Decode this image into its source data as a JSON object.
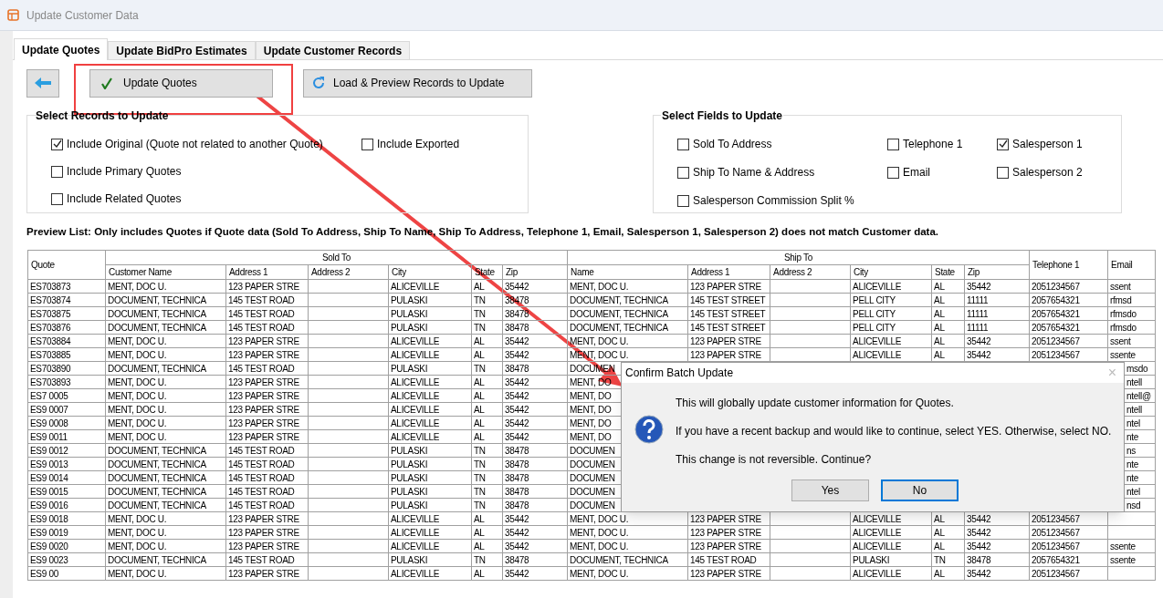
{
  "window": {
    "title": "Update Customer Data"
  },
  "tabs": [
    {
      "label": "Update Quotes",
      "selected": true
    },
    {
      "label": "Update BidPro Estimates",
      "selected": false
    },
    {
      "label": "Update Customer Records",
      "selected": false
    }
  ],
  "toolbar": {
    "update_button": "Update Quotes",
    "load_button": "Load & Preview Records to Update"
  },
  "records_group": {
    "title": "Select Records to Update",
    "options": [
      {
        "label": "Include Original (Quote not related to another Quote)",
        "checked": true
      },
      {
        "label": "Include Exported",
        "checked": false
      },
      {
        "label": "Include Primary Quotes",
        "checked": false
      },
      {
        "label": "Include Related Quotes",
        "checked": false
      }
    ]
  },
  "fields_group": {
    "title": "Select Fields to Update",
    "options": [
      {
        "label": "Sold To Address",
        "checked": false
      },
      {
        "label": "Telephone 1",
        "checked": false
      },
      {
        "label": "Salesperson 1",
        "checked": true
      },
      {
        "label": "Ship To Name & Address",
        "checked": false
      },
      {
        "label": "Email",
        "checked": false
      },
      {
        "label": "Salesperson 2",
        "checked": false
      },
      {
        "label": "Salesperson Commission Split %",
        "checked": false
      }
    ]
  },
  "preview_note": "Preview List:  Only includes Quotes if Quote data (Sold To Address, Ship To Name, Ship To Address, Telephone 1, Email, Salesperson 1, Salesperson 2) does not match Customer data.",
  "table": {
    "groups": [
      "Sold To",
      "Ship To"
    ],
    "columns": [
      "Quote",
      "Customer Name",
      "Address 1",
      "Address 2",
      "City",
      "State",
      "Zip",
      "Name",
      "Address 1",
      "Address 2",
      "City",
      "State",
      "Zip",
      "Telephone 1",
      "Email"
    ],
    "rows": [
      {
        "cells": [
          "ES703873",
          "MENT, DOC U.",
          "123 PAPER STRE",
          null,
          "ALICEVILLE",
          "AL",
          "35442",
          "MENT, DOC U.",
          "123 PAPER STRE",
          null,
          "ALICEVILLE",
          "AL",
          "35442",
          "2051234567",
          "ssent"
        ]
      },
      {
        "cells": [
          "ES703874",
          "DOCUMENT, TECHNICA",
          "145 TEST ROAD",
          null,
          "PULASKI",
          "TN",
          "38478",
          "DOCUMENT, TECHNICA",
          "145 TEST STREET",
          null,
          "PELL CITY",
          "AL",
          "11111",
          "2057654321",
          "rfmsd"
        ]
      },
      {
        "cells": [
          "ES703875",
          "DOCUMENT, TECHNICA",
          "145 TEST ROAD",
          null,
          "PULASKI",
          "TN",
          "38478",
          "DOCUMENT, TECHNICA",
          "145 TEST STREET",
          null,
          "PELL CITY",
          "AL",
          "11111",
          "2057654321",
          "rfmsdo"
        ]
      },
      {
        "cells": [
          "ES703876",
          "DOCUMENT, TECHNICA",
          "145 TEST ROAD",
          null,
          "PULASKI",
          "TN",
          "38478",
          "DOCUMENT, TECHNICA",
          "145 TEST STREET",
          null,
          "PELL CITY",
          "AL",
          "11111",
          "2057654321",
          "rfmsdo"
        ]
      },
      {
        "cells": [
          "ES703884",
          "MENT, DOC U.",
          "123 PAPER STRE",
          null,
          "ALICEVILLE",
          "AL",
          "35442",
          "MENT, DOC U.",
          "123 PAPER STRE",
          null,
          "ALICEVILLE",
          "AL",
          "35442",
          "2051234567",
          "ssent"
        ]
      },
      {
        "cells": [
          "ES703885",
          "MENT, DOC U.",
          "123 PAPER STRE",
          null,
          "ALICEVILLE",
          "AL",
          "35442",
          "MENT, DOC U.",
          "123 PAPER STRE",
          null,
          "ALICEVILLE",
          "AL",
          "35442",
          "2051234567",
          "ssente"
        ]
      },
      {
        "cells": [
          "ES703890",
          "DOCUMENT, TECHNICA",
          "145 TEST ROAD",
          null,
          "PULASKI",
          "TN",
          "38478",
          "DOCUMEN",
          null,
          null,
          null,
          null,
          null,
          null,
          "msdo"
        ]
      },
      {
        "cells": [
          "ES703893",
          "MENT, DOC U.",
          "123 PAPER STRE",
          null,
          "ALICEVILLE",
          "AL",
          "35442",
          "MENT, DO",
          null,
          null,
          null,
          null,
          null,
          null,
          "ntell"
        ]
      },
      {
        "cells": [
          "ES7 0005",
          "MENT, DOC U.",
          "123 PAPER STRE",
          null,
          "ALICEVILLE",
          "AL",
          "35442",
          "MENT, DO",
          null,
          null,
          null,
          null,
          null,
          null,
          "ntell@"
        ]
      },
      {
        "cells": [
          "ES9 0007",
          "MENT, DOC U.",
          "123 PAPER STRE",
          null,
          "ALICEVILLE",
          "AL",
          "35442",
          "MENT, DO",
          null,
          null,
          null,
          null,
          null,
          null,
          "ntell"
        ]
      },
      {
        "cells": [
          "ES9 0008",
          "MENT, DOC U.",
          "123 PAPER STRE",
          null,
          "ALICEVILLE",
          "AL",
          "35442",
          "MENT, DO",
          null,
          null,
          null,
          null,
          null,
          null,
          "ntel"
        ]
      },
      {
        "cells": [
          "ES9 0011",
          "MENT, DOC U.",
          "123 PAPER STRE",
          null,
          "ALICEVILLE",
          "AL",
          "35442",
          "MENT, DO",
          null,
          null,
          null,
          null,
          null,
          null,
          "nte"
        ]
      },
      {
        "cells": [
          "ES9 0012",
          "DOCUMENT, TECHNICA",
          "145 TEST ROAD",
          null,
          "PULASKI",
          "TN",
          "38478",
          "DOCUMEN",
          null,
          null,
          null,
          null,
          null,
          null,
          "ns"
        ]
      },
      {
        "cells": [
          "ES9 0013",
          "DOCUMENT, TECHNICA",
          "145 TEST ROAD",
          null,
          "PULASKI",
          "TN",
          "38478",
          "DOCUMEN",
          null,
          null,
          null,
          null,
          null,
          null,
          "nte"
        ]
      },
      {
        "cells": [
          "ES9 0014",
          "DOCUMENT, TECHNICA",
          "145 TEST ROAD",
          null,
          "PULASKI",
          "TN",
          "38478",
          "DOCUMEN",
          null,
          null,
          null,
          null,
          null,
          null,
          "nte"
        ]
      },
      {
        "cells": [
          "ES9 0015",
          "DOCUMENT, TECHNICA",
          "145 TEST ROAD",
          null,
          "PULASKI",
          "TN",
          "38478",
          "DOCUMEN",
          null,
          null,
          null,
          null,
          null,
          null,
          "ntel"
        ]
      },
      {
        "cells": [
          "ES9 0016",
          "DOCUMENT, TECHNICA",
          "145 TEST ROAD",
          null,
          "PULASKI",
          "TN",
          "38478",
          "DOCUMEN",
          null,
          null,
          null,
          null,
          null,
          null,
          "nsd"
        ]
      },
      {
        "cells": [
          "ES9 0018",
          "MENT, DOC U.",
          "123 PAPER STRE",
          null,
          "ALICEVILLE",
          "AL",
          "35442",
          "MENT, DOC U.",
          "123 PAPER STRE",
          null,
          "ALICEVILLE",
          "AL",
          "35442",
          "2051234567",
          null
        ]
      },
      {
        "cells": [
          "ES9 0019",
          "MENT, DOC U.",
          "123 PAPER STRE",
          null,
          "ALICEVILLE",
          "AL",
          "35442",
          "MENT, DOC U.",
          "123 PAPER STRE",
          null,
          "ALICEVILLE",
          "AL",
          "35442",
          "2051234567",
          null
        ]
      },
      {
        "cells": [
          "ES9 0020",
          "MENT, DOC U.",
          "123 PAPER STRE",
          null,
          "ALICEVILLE",
          "AL",
          "35442",
          "MENT, DOC U.",
          "123 PAPER STRE",
          null,
          "ALICEVILLE",
          "AL",
          "35442",
          "2051234567",
          "ssente"
        ]
      },
      {
        "cells": [
          "ES9 0023",
          "DOCUMENT, TECHNICA",
          "145 TEST ROAD",
          null,
          "PULASKI",
          "TN",
          "38478",
          "DOCUMENT, TECHNICA",
          "145 TEST ROAD",
          null,
          "PULASKI",
          "TN",
          "38478",
          "2057654321",
          "ssente"
        ]
      },
      {
        "cells": [
          "ES9 00",
          "MENT, DOC U.",
          "123 PAPER STRE",
          null,
          "ALICEVILLE",
          "AL",
          "35442",
          "MENT, DOC U.",
          "123 PAPER STRE",
          null,
          "ALICEVILLE",
          "AL",
          "35442",
          "2051234567",
          null
        ]
      }
    ]
  },
  "dialog": {
    "title": "Confirm Batch Update",
    "close": "×",
    "messages": [
      "This will globally update customer information for Quotes.",
      "If you have a recent backup and would like to continue, select YES.  Otherwise, select NO.",
      "This change is not reversible.  Continue?"
    ],
    "buttons": [
      {
        "label": "Yes",
        "selected": false
      },
      {
        "label": "No",
        "selected": true
      }
    ]
  }
}
